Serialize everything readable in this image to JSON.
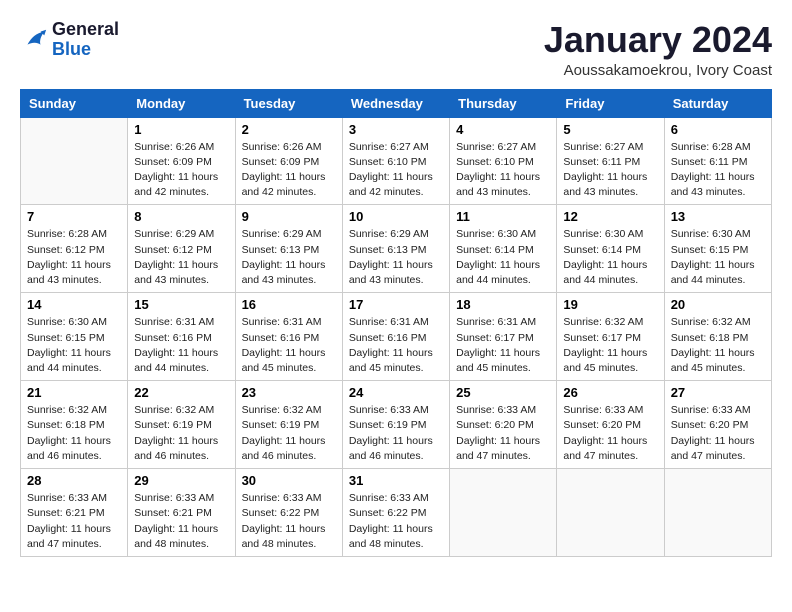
{
  "header": {
    "logo_line1": "General",
    "logo_line2": "Blue",
    "month": "January 2024",
    "location": "Aoussakamoekrou, Ivory Coast"
  },
  "weekdays": [
    "Sunday",
    "Monday",
    "Tuesday",
    "Wednesday",
    "Thursday",
    "Friday",
    "Saturday"
  ],
  "weeks": [
    [
      {
        "day": "",
        "sunrise": "",
        "sunset": "",
        "daylight": ""
      },
      {
        "day": "1",
        "sunrise": "Sunrise: 6:26 AM",
        "sunset": "Sunset: 6:09 PM",
        "daylight": "Daylight: 11 hours and 42 minutes."
      },
      {
        "day": "2",
        "sunrise": "Sunrise: 6:26 AM",
        "sunset": "Sunset: 6:09 PM",
        "daylight": "Daylight: 11 hours and 42 minutes."
      },
      {
        "day": "3",
        "sunrise": "Sunrise: 6:27 AM",
        "sunset": "Sunset: 6:10 PM",
        "daylight": "Daylight: 11 hours and 42 minutes."
      },
      {
        "day": "4",
        "sunrise": "Sunrise: 6:27 AM",
        "sunset": "Sunset: 6:10 PM",
        "daylight": "Daylight: 11 hours and 43 minutes."
      },
      {
        "day": "5",
        "sunrise": "Sunrise: 6:27 AM",
        "sunset": "Sunset: 6:11 PM",
        "daylight": "Daylight: 11 hours and 43 minutes."
      },
      {
        "day": "6",
        "sunrise": "Sunrise: 6:28 AM",
        "sunset": "Sunset: 6:11 PM",
        "daylight": "Daylight: 11 hours and 43 minutes."
      }
    ],
    [
      {
        "day": "7",
        "sunrise": "Sunrise: 6:28 AM",
        "sunset": "Sunset: 6:12 PM",
        "daylight": "Daylight: 11 hours and 43 minutes."
      },
      {
        "day": "8",
        "sunrise": "Sunrise: 6:29 AM",
        "sunset": "Sunset: 6:12 PM",
        "daylight": "Daylight: 11 hours and 43 minutes."
      },
      {
        "day": "9",
        "sunrise": "Sunrise: 6:29 AM",
        "sunset": "Sunset: 6:13 PM",
        "daylight": "Daylight: 11 hours and 43 minutes."
      },
      {
        "day": "10",
        "sunrise": "Sunrise: 6:29 AM",
        "sunset": "Sunset: 6:13 PM",
        "daylight": "Daylight: 11 hours and 43 minutes."
      },
      {
        "day": "11",
        "sunrise": "Sunrise: 6:30 AM",
        "sunset": "Sunset: 6:14 PM",
        "daylight": "Daylight: 11 hours and 44 minutes."
      },
      {
        "day": "12",
        "sunrise": "Sunrise: 6:30 AM",
        "sunset": "Sunset: 6:14 PM",
        "daylight": "Daylight: 11 hours and 44 minutes."
      },
      {
        "day": "13",
        "sunrise": "Sunrise: 6:30 AM",
        "sunset": "Sunset: 6:15 PM",
        "daylight": "Daylight: 11 hours and 44 minutes."
      }
    ],
    [
      {
        "day": "14",
        "sunrise": "Sunrise: 6:30 AM",
        "sunset": "Sunset: 6:15 PM",
        "daylight": "Daylight: 11 hours and 44 minutes."
      },
      {
        "day": "15",
        "sunrise": "Sunrise: 6:31 AM",
        "sunset": "Sunset: 6:16 PM",
        "daylight": "Daylight: 11 hours and 44 minutes."
      },
      {
        "day": "16",
        "sunrise": "Sunrise: 6:31 AM",
        "sunset": "Sunset: 6:16 PM",
        "daylight": "Daylight: 11 hours and 45 minutes."
      },
      {
        "day": "17",
        "sunrise": "Sunrise: 6:31 AM",
        "sunset": "Sunset: 6:16 PM",
        "daylight": "Daylight: 11 hours and 45 minutes."
      },
      {
        "day": "18",
        "sunrise": "Sunrise: 6:31 AM",
        "sunset": "Sunset: 6:17 PM",
        "daylight": "Daylight: 11 hours and 45 minutes."
      },
      {
        "day": "19",
        "sunrise": "Sunrise: 6:32 AM",
        "sunset": "Sunset: 6:17 PM",
        "daylight": "Daylight: 11 hours and 45 minutes."
      },
      {
        "day": "20",
        "sunrise": "Sunrise: 6:32 AM",
        "sunset": "Sunset: 6:18 PM",
        "daylight": "Daylight: 11 hours and 45 minutes."
      }
    ],
    [
      {
        "day": "21",
        "sunrise": "Sunrise: 6:32 AM",
        "sunset": "Sunset: 6:18 PM",
        "daylight": "Daylight: 11 hours and 46 minutes."
      },
      {
        "day": "22",
        "sunrise": "Sunrise: 6:32 AM",
        "sunset": "Sunset: 6:19 PM",
        "daylight": "Daylight: 11 hours and 46 minutes."
      },
      {
        "day": "23",
        "sunrise": "Sunrise: 6:32 AM",
        "sunset": "Sunset: 6:19 PM",
        "daylight": "Daylight: 11 hours and 46 minutes."
      },
      {
        "day": "24",
        "sunrise": "Sunrise: 6:33 AM",
        "sunset": "Sunset: 6:19 PM",
        "daylight": "Daylight: 11 hours and 46 minutes."
      },
      {
        "day": "25",
        "sunrise": "Sunrise: 6:33 AM",
        "sunset": "Sunset: 6:20 PM",
        "daylight": "Daylight: 11 hours and 47 minutes."
      },
      {
        "day": "26",
        "sunrise": "Sunrise: 6:33 AM",
        "sunset": "Sunset: 6:20 PM",
        "daylight": "Daylight: 11 hours and 47 minutes."
      },
      {
        "day": "27",
        "sunrise": "Sunrise: 6:33 AM",
        "sunset": "Sunset: 6:20 PM",
        "daylight": "Daylight: 11 hours and 47 minutes."
      }
    ],
    [
      {
        "day": "28",
        "sunrise": "Sunrise: 6:33 AM",
        "sunset": "Sunset: 6:21 PM",
        "daylight": "Daylight: 11 hours and 47 minutes."
      },
      {
        "day": "29",
        "sunrise": "Sunrise: 6:33 AM",
        "sunset": "Sunset: 6:21 PM",
        "daylight": "Daylight: 11 hours and 48 minutes."
      },
      {
        "day": "30",
        "sunrise": "Sunrise: 6:33 AM",
        "sunset": "Sunset: 6:22 PM",
        "daylight": "Daylight: 11 hours and 48 minutes."
      },
      {
        "day": "31",
        "sunrise": "Sunrise: 6:33 AM",
        "sunset": "Sunset: 6:22 PM",
        "daylight": "Daylight: 11 hours and 48 minutes."
      },
      {
        "day": "",
        "sunrise": "",
        "sunset": "",
        "daylight": ""
      },
      {
        "day": "",
        "sunrise": "",
        "sunset": "",
        "daylight": ""
      },
      {
        "day": "",
        "sunrise": "",
        "sunset": "",
        "daylight": ""
      }
    ]
  ]
}
